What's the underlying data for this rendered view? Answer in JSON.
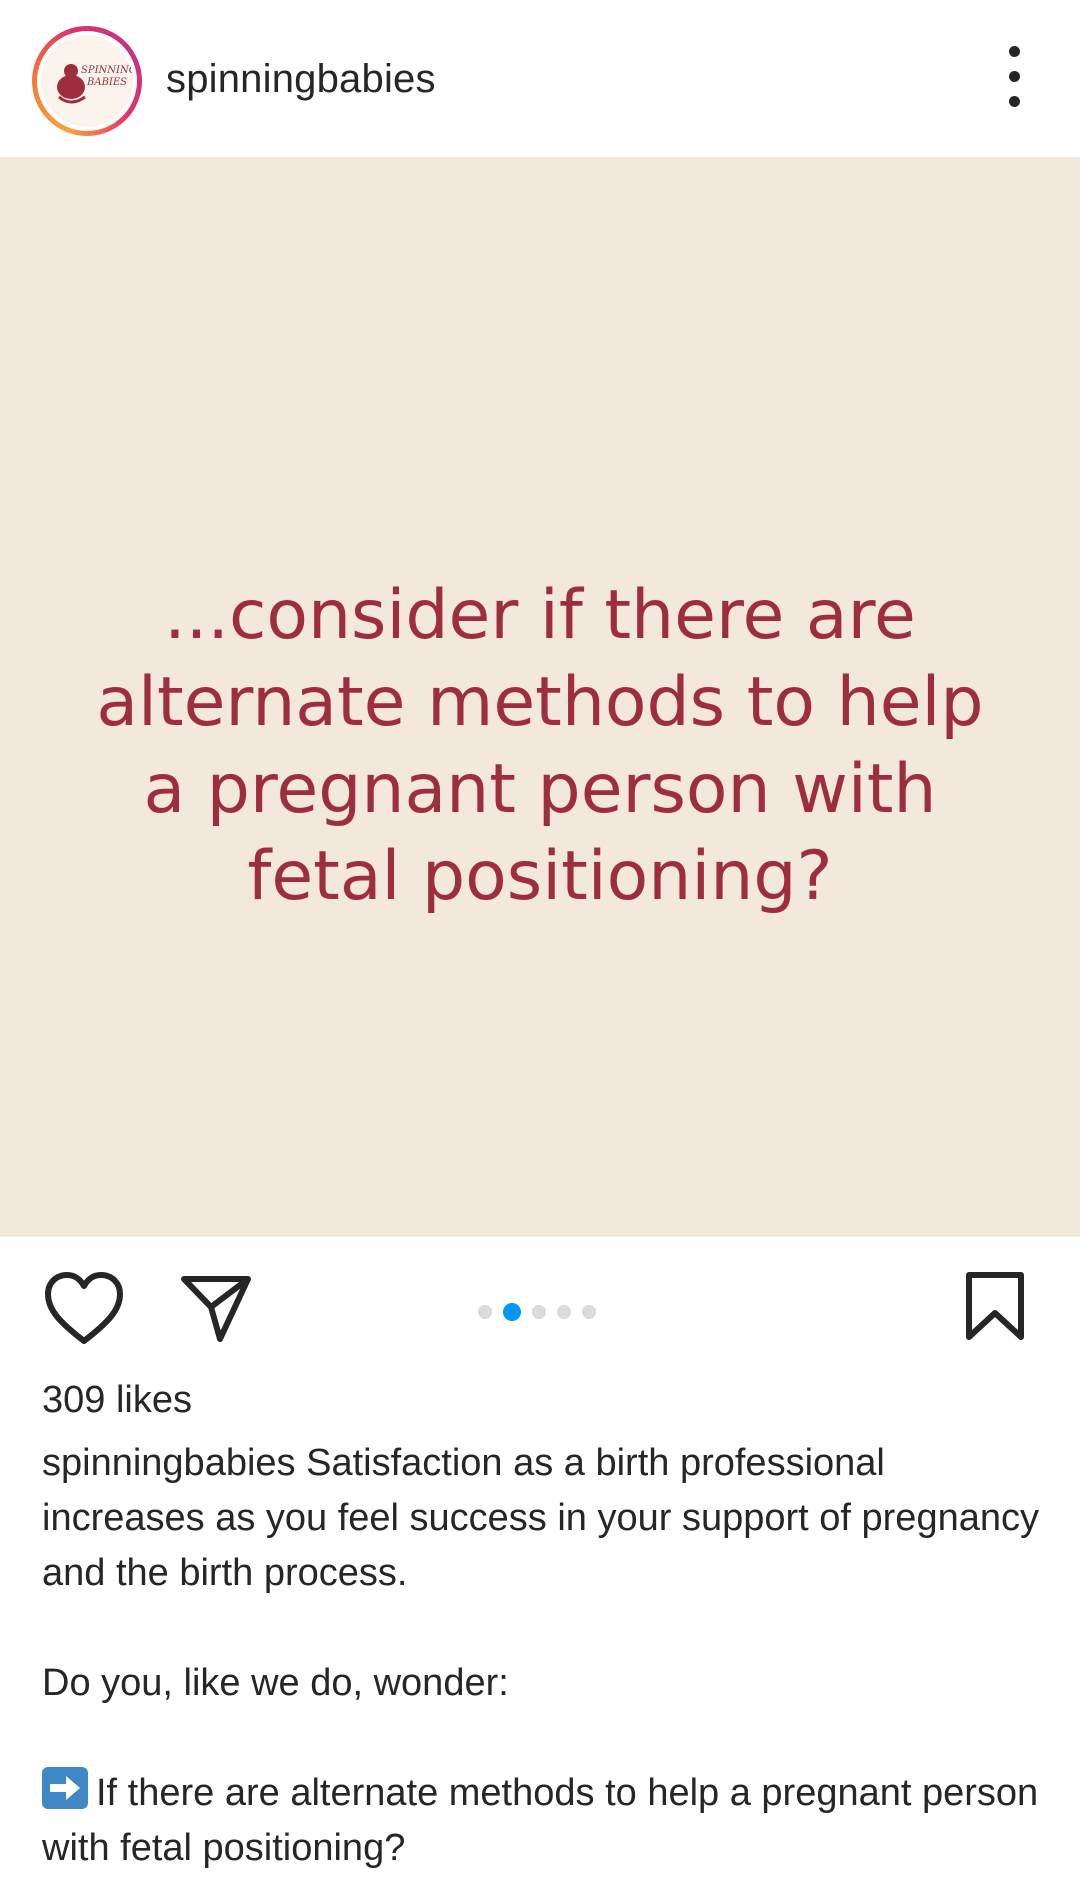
{
  "header": {
    "username": "spinningbabies",
    "avatar_logo_text": "Spinning Babies",
    "avatar_icon": "brand-logo",
    "more_icon": "more-vertical-icon"
  },
  "post": {
    "image_text": "...consider if there are alternate methods to help a pregnant person with fetal positioning?",
    "image_background": "#f2e8dc",
    "image_text_color": "#9e2e3e"
  },
  "actions": {
    "like_icon": "heart-icon",
    "share_icon": "send-icon",
    "save_icon": "bookmark-icon",
    "carousel": {
      "total": 5,
      "active_index": 1,
      "active_color": "#0095f6"
    }
  },
  "likes": "309 likes",
  "caption": {
    "username": "spinningbabies",
    "intro": "Satisfaction as a birth professional increases as you feel success in your support of pregnancy and the birth process.",
    "question": "Do you, like we do, wonder:",
    "bullet_icon": "arrow-right-emoji",
    "bullet": "If there are alternate methods to help a pregnant person with fetal positioning?"
  }
}
